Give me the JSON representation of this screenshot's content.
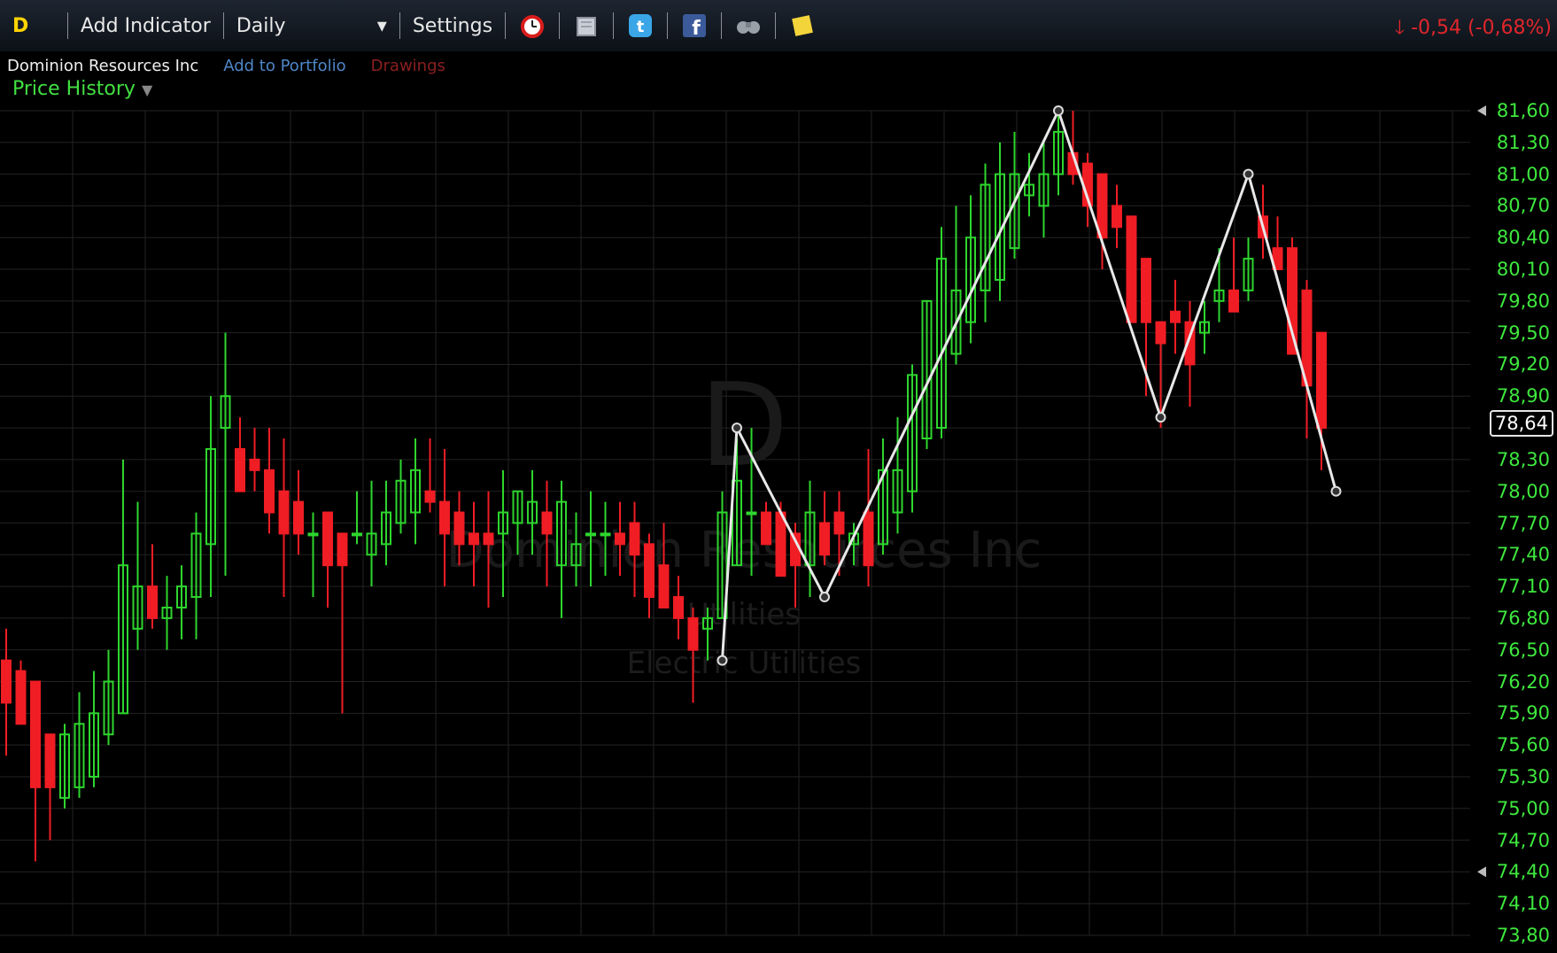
{
  "toolbar": {
    "symbol": "D",
    "add_indicator": "Add Indicator",
    "period": "Daily",
    "settings": "Settings",
    "icons": [
      "alarm-clock-icon",
      "book-icon",
      "twitter-icon",
      "facebook-icon",
      "binoculars-icon",
      "sticky-note-icon"
    ],
    "change": "-0,54 (-0,68%)"
  },
  "subbar": {
    "company": "Dominion Resources Inc",
    "add_portfolio": "Add to Portfolio",
    "drawings": "Drawings"
  },
  "panel": {
    "label": "Price History"
  },
  "watermark": {
    "symbol": "D",
    "company": "Dominion Resources Inc",
    "sector": "Utilities",
    "industry": "Electric Utilities"
  },
  "colors": {
    "up": "#2ed62e",
    "down": "#f01d24",
    "grid": "#232323",
    "axis": "#3ee83e",
    "pattern": "#e8e8e8"
  },
  "chart_data": {
    "type": "candlestick",
    "y_ticks": [
      "81,60",
      "81,30",
      "81,00",
      "80,70",
      "80,40",
      "80,10",
      "79,80",
      "79,50",
      "79,20",
      "78,90",
      "78,60",
      "78,30",
      "78,00",
      "77,70",
      "77,40",
      "77,10",
      "76,80",
      "76,50",
      "76,20",
      "75,90",
      "75,60",
      "75,30",
      "75,00",
      "74,70",
      "74,40",
      "74,10",
      "73,80"
    ],
    "ylim": [
      73.8,
      81.6
    ],
    "last_price": "78,64",
    "candles": [
      {
        "o": 76.4,
        "h": 76.7,
        "l": 75.5,
        "c": 76.0
      },
      {
        "o": 76.3,
        "h": 76.4,
        "l": 75.8,
        "c": 75.8
      },
      {
        "o": 76.2,
        "h": 76.2,
        "l": 74.5,
        "c": 75.2
      },
      {
        "o": 75.7,
        "h": 75.7,
        "l": 74.7,
        "c": 75.2
      },
      {
        "o": 75.1,
        "h": 75.8,
        "l": 75.0,
        "c": 75.7
      },
      {
        "o": 75.2,
        "h": 76.1,
        "l": 75.1,
        "c": 75.8
      },
      {
        "o": 75.3,
        "h": 76.3,
        "l": 75.2,
        "c": 75.9
      },
      {
        "o": 75.7,
        "h": 76.5,
        "l": 75.6,
        "c": 76.2
      },
      {
        "o": 75.9,
        "h": 78.3,
        "l": 75.9,
        "c": 77.3
      },
      {
        "o": 76.7,
        "h": 77.9,
        "l": 76.5,
        "c": 77.1
      },
      {
        "o": 77.1,
        "h": 77.5,
        "l": 76.7,
        "c": 76.8
      },
      {
        "o": 76.8,
        "h": 77.2,
        "l": 76.5,
        "c": 76.9
      },
      {
        "o": 76.9,
        "h": 77.3,
        "l": 76.6,
        "c": 77.1
      },
      {
        "o": 77.0,
        "h": 77.8,
        "l": 76.6,
        "c": 77.6
      },
      {
        "o": 77.5,
        "h": 78.9,
        "l": 77.0,
        "c": 78.4
      },
      {
        "o": 78.6,
        "h": 79.5,
        "l": 77.2,
        "c": 78.9
      },
      {
        "o": 78.4,
        "h": 78.7,
        "l": 78.3,
        "c": 78.0
      },
      {
        "o": 78.3,
        "h": 78.6,
        "l": 78.0,
        "c": 78.2
      },
      {
        "o": 78.2,
        "h": 78.6,
        "l": 77.6,
        "c": 77.8
      },
      {
        "o": 78.0,
        "h": 78.5,
        "l": 77.0,
        "c": 77.6
      },
      {
        "o": 77.9,
        "h": 78.2,
        "l": 77.4,
        "c": 77.6
      },
      {
        "o": 77.6,
        "h": 77.8,
        "l": 77.0,
        "c": 77.6
      },
      {
        "o": 77.8,
        "h": 77.8,
        "l": 76.9,
        "c": 77.3
      },
      {
        "o": 77.6,
        "h": 77.6,
        "l": 75.9,
        "c": 77.3
      },
      {
        "o": 77.6,
        "h": 78.0,
        "l": 77.5,
        "c": 77.6
      },
      {
        "o": 77.4,
        "h": 78.1,
        "l": 77.1,
        "c": 77.6
      },
      {
        "o": 77.5,
        "h": 78.1,
        "l": 77.3,
        "c": 77.8
      },
      {
        "o": 77.7,
        "h": 78.3,
        "l": 77.6,
        "c": 78.1
      },
      {
        "o": 77.8,
        "h": 78.5,
        "l": 77.5,
        "c": 78.2
      },
      {
        "o": 78.0,
        "h": 78.5,
        "l": 77.8,
        "c": 77.9
      },
      {
        "o": 77.9,
        "h": 78.4,
        "l": 77.1,
        "c": 77.6
      },
      {
        "o": 77.8,
        "h": 78.0,
        "l": 77.3,
        "c": 77.5
      },
      {
        "o": 77.6,
        "h": 77.9,
        "l": 77.1,
        "c": 77.5
      },
      {
        "o": 77.6,
        "h": 78.0,
        "l": 76.9,
        "c": 77.5
      },
      {
        "o": 77.6,
        "h": 78.2,
        "l": 77.0,
        "c": 77.8
      },
      {
        "o": 77.7,
        "h": 78.0,
        "l": 77.4,
        "c": 78.0
      },
      {
        "o": 77.7,
        "h": 78.2,
        "l": 77.4,
        "c": 77.9
      },
      {
        "o": 77.8,
        "h": 78.1,
        "l": 77.1,
        "c": 77.6
      },
      {
        "o": 77.3,
        "h": 78.1,
        "l": 76.8,
        "c": 77.9
      },
      {
        "o": 77.3,
        "h": 77.8,
        "l": 77.1,
        "c": 77.5
      },
      {
        "o": 77.6,
        "h": 78.0,
        "l": 77.1,
        "c": 77.6
      },
      {
        "o": 77.6,
        "h": 77.9,
        "l": 77.2,
        "c": 77.6
      },
      {
        "o": 77.6,
        "h": 77.9,
        "l": 77.2,
        "c": 77.5
      },
      {
        "o": 77.7,
        "h": 77.9,
        "l": 77.0,
        "c": 77.4
      },
      {
        "o": 77.5,
        "h": 77.6,
        "l": 76.8,
        "c": 77.0
      },
      {
        "o": 77.3,
        "h": 77.7,
        "l": 76.9,
        "c": 76.9
      },
      {
        "o": 77.0,
        "h": 77.2,
        "l": 76.6,
        "c": 76.8
      },
      {
        "o": 76.8,
        "h": 76.9,
        "l": 76.0,
        "c": 76.5
      },
      {
        "o": 76.7,
        "h": 76.9,
        "l": 76.4,
        "c": 76.8
      },
      {
        "o": 76.8,
        "h": 78.0,
        "l": 76.8,
        "c": 77.8
      },
      {
        "o": 77.3,
        "h": 78.5,
        "l": 77.3,
        "c": 78.1
      },
      {
        "o": 77.8,
        "h": 78.6,
        "l": 77.2,
        "c": 77.8
      },
      {
        "o": 77.8,
        "h": 77.9,
        "l": 77.5,
        "c": 77.5
      },
      {
        "o": 77.8,
        "h": 77.9,
        "l": 77.3,
        "c": 77.2
      },
      {
        "o": 77.6,
        "h": 77.7,
        "l": 76.9,
        "c": 77.3
      },
      {
        "o": 77.3,
        "h": 78.1,
        "l": 77.0,
        "c": 77.8
      },
      {
        "o": 77.7,
        "h": 78.0,
        "l": 77.3,
        "c": 77.4
      },
      {
        "o": 77.8,
        "h": 78.0,
        "l": 77.2,
        "c": 77.6
      },
      {
        "o": 77.5,
        "h": 77.7,
        "l": 77.3,
        "c": 77.6
      },
      {
        "o": 77.8,
        "h": 78.4,
        "l": 77.1,
        "c": 77.3
      },
      {
        "o": 77.5,
        "h": 78.5,
        "l": 77.4,
        "c": 78.2
      },
      {
        "o": 77.8,
        "h": 78.7,
        "l": 77.6,
        "c": 78.2
      },
      {
        "o": 78.0,
        "h": 79.2,
        "l": 77.8,
        "c": 79.1
      },
      {
        "o": 78.5,
        "h": 79.8,
        "l": 78.4,
        "c": 79.8
      },
      {
        "o": 78.6,
        "h": 80.5,
        "l": 78.5,
        "c": 80.2
      },
      {
        "o": 79.3,
        "h": 80.7,
        "l": 79.2,
        "c": 79.9
      },
      {
        "o": 79.6,
        "h": 80.8,
        "l": 79.4,
        "c": 80.4
      },
      {
        "o": 79.9,
        "h": 81.1,
        "l": 79.6,
        "c": 80.9
      },
      {
        "o": 80.0,
        "h": 81.3,
        "l": 79.8,
        "c": 81.0
      },
      {
        "o": 80.3,
        "h": 81.4,
        "l": 80.2,
        "c": 81.0
      },
      {
        "o": 80.8,
        "h": 81.2,
        "l": 80.6,
        "c": 80.9
      },
      {
        "o": 80.7,
        "h": 81.3,
        "l": 80.4,
        "c": 81.0
      },
      {
        "o": 81.0,
        "h": 81.6,
        "l": 80.8,
        "c": 81.4
      },
      {
        "o": 81.2,
        "h": 81.6,
        "l": 80.9,
        "c": 81.0
      },
      {
        "o": 81.1,
        "h": 81.2,
        "l": 80.5,
        "c": 80.7
      },
      {
        "o": 81.0,
        "h": 81.0,
        "l": 80.1,
        "c": 80.4
      },
      {
        "o": 80.7,
        "h": 80.9,
        "l": 80.3,
        "c": 80.5
      },
      {
        "o": 80.6,
        "h": 80.6,
        "l": 79.8,
        "c": 79.6
      },
      {
        "o": 80.2,
        "h": 80.2,
        "l": 78.9,
        "c": 79.6
      },
      {
        "o": 79.6,
        "h": 79.6,
        "l": 78.6,
        "c": 79.4
      },
      {
        "o": 79.7,
        "h": 80.0,
        "l": 79.3,
        "c": 79.6
      },
      {
        "o": 79.6,
        "h": 79.8,
        "l": 78.8,
        "c": 79.2
      },
      {
        "o": 79.5,
        "h": 79.8,
        "l": 79.3,
        "c": 79.6
      },
      {
        "o": 79.8,
        "h": 80.3,
        "l": 79.6,
        "c": 79.9
      },
      {
        "o": 79.9,
        "h": 80.4,
        "l": 79.7,
        "c": 79.7
      },
      {
        "o": 79.9,
        "h": 80.4,
        "l": 79.8,
        "c": 80.2
      },
      {
        "o": 80.6,
        "h": 80.9,
        "l": 80.2,
        "c": 80.4
      },
      {
        "o": 80.3,
        "h": 80.6,
        "l": 80.2,
        "c": 80.1
      },
      {
        "o": 80.3,
        "h": 80.4,
        "l": 79.4,
        "c": 79.3
      },
      {
        "o": 79.9,
        "h": 80.0,
        "l": 78.5,
        "c": 79.0
      },
      {
        "o": 79.5,
        "h": 79.5,
        "l": 78.2,
        "c": 78.6
      }
    ],
    "pattern_points": [
      {
        "i": 49,
        "v": 76.4
      },
      {
        "i": 50,
        "v": 78.6
      },
      {
        "i": 56,
        "v": 77.0
      },
      {
        "i": 72,
        "v": 81.6
      },
      {
        "i": 79,
        "v": 78.7
      },
      {
        "i": 85,
        "v": 81.0
      },
      {
        "i": 91,
        "v": 78.0
      }
    ],
    "grid": true
  }
}
